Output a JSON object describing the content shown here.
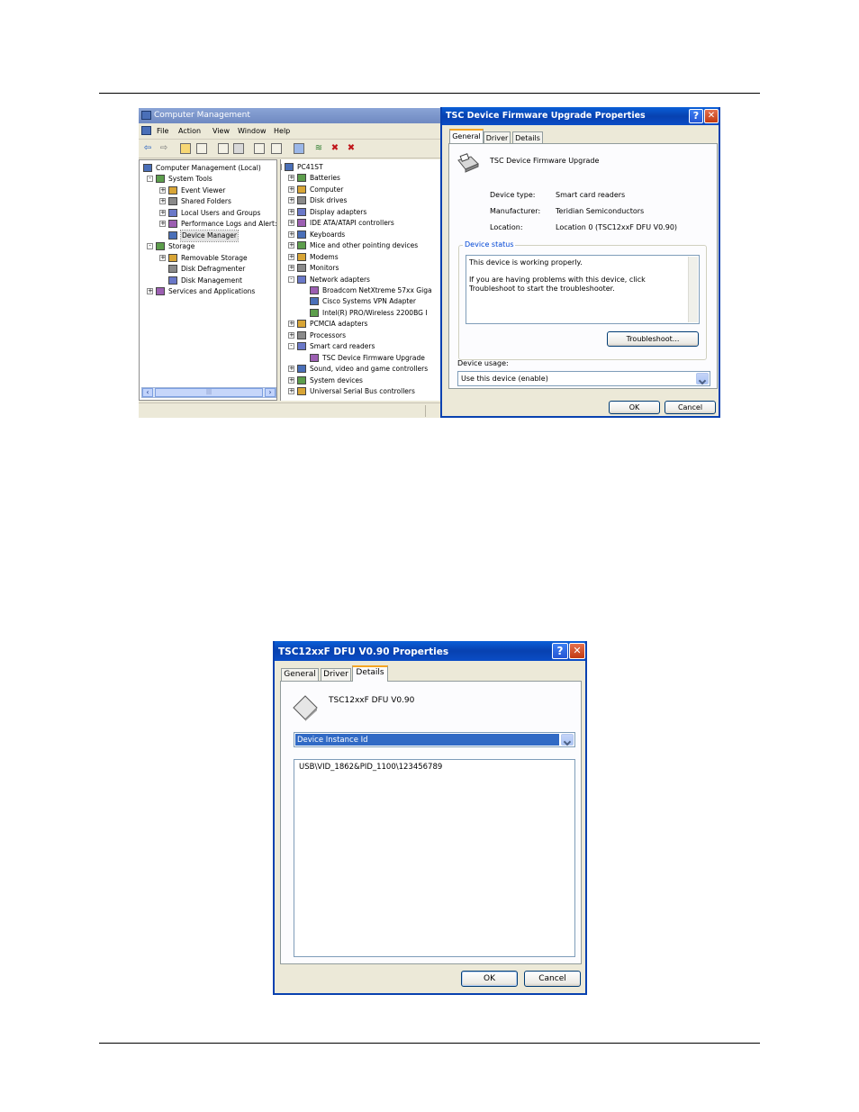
{
  "computer_management": {
    "title": "Computer Management",
    "menu": [
      "File",
      "Action",
      "View",
      "Window",
      "Help"
    ],
    "left_tree": [
      {
        "label": "Computer Management (Local)",
        "level": 0,
        "expander": "",
        "icon": "computer-icon"
      },
      {
        "label": "System Tools",
        "level": 1,
        "expander": "-",
        "icon": "tools-icon"
      },
      {
        "label": "Event Viewer",
        "level": 2,
        "expander": "+",
        "icon": "event-viewer-icon"
      },
      {
        "label": "Shared Folders",
        "level": 2,
        "expander": "+",
        "icon": "folder-icon"
      },
      {
        "label": "Local Users and Groups",
        "level": 2,
        "expander": "+",
        "icon": "users-icon"
      },
      {
        "label": "Performance Logs and Alert:",
        "level": 2,
        "expander": "+",
        "icon": "performance-icon"
      },
      {
        "label": "Device Manager",
        "level": 2,
        "expander": "",
        "icon": "device-manager-icon",
        "selected": true
      },
      {
        "label": "Storage",
        "level": 1,
        "expander": "-",
        "icon": "storage-icon"
      },
      {
        "label": "Removable Storage",
        "level": 2,
        "expander": "+",
        "icon": "removable-storage-icon"
      },
      {
        "label": "Disk Defragmenter",
        "level": 2,
        "expander": "",
        "icon": "defrag-icon"
      },
      {
        "label": "Disk Management",
        "level": 2,
        "expander": "",
        "icon": "disk-icon"
      },
      {
        "label": "Services and Applications",
        "level": 1,
        "expander": "+",
        "icon": "services-icon"
      }
    ],
    "right_tree": [
      {
        "label": "PC41ST",
        "level": 0,
        "expander": "-",
        "icon": "computer-icon"
      },
      {
        "label": "Batteries",
        "level": 1,
        "expander": "+",
        "icon": "battery-icon"
      },
      {
        "label": "Computer",
        "level": 1,
        "expander": "+",
        "icon": "computer-icon"
      },
      {
        "label": "Disk drives",
        "level": 1,
        "expander": "+",
        "icon": "disk-icon"
      },
      {
        "label": "Display adapters",
        "level": 1,
        "expander": "+",
        "icon": "display-icon"
      },
      {
        "label": "IDE ATA/ATAPI controllers",
        "level": 1,
        "expander": "+",
        "icon": "ide-icon"
      },
      {
        "label": "Keyboards",
        "level": 1,
        "expander": "+",
        "icon": "keyboard-icon"
      },
      {
        "label": "Mice and other pointing devices",
        "level": 1,
        "expander": "+",
        "icon": "mouse-icon"
      },
      {
        "label": "Modems",
        "level": 1,
        "expander": "+",
        "icon": "modem-icon"
      },
      {
        "label": "Monitors",
        "level": 1,
        "expander": "+",
        "icon": "monitor-icon"
      },
      {
        "label": "Network adapters",
        "level": 1,
        "expander": "-",
        "icon": "network-icon"
      },
      {
        "label": "Broadcom NetXtreme 57xx Giga",
        "level": 2,
        "expander": "",
        "icon": "network-card-icon"
      },
      {
        "label": "Cisco Systems VPN Adapter",
        "level": 2,
        "expander": "",
        "icon": "network-card-icon"
      },
      {
        "label": "Intel(R) PRO/Wireless 2200BG I",
        "level": 2,
        "expander": "",
        "icon": "network-card-icon"
      },
      {
        "label": "PCMCIA adapters",
        "level": 1,
        "expander": "+",
        "icon": "pcmcia-icon"
      },
      {
        "label": "Processors",
        "level": 1,
        "expander": "+",
        "icon": "processor-icon"
      },
      {
        "label": "Smart card readers",
        "level": 1,
        "expander": "-",
        "icon": "smart-card-reader-icon"
      },
      {
        "label": "TSC Device Firmware Upgrade",
        "level": 2,
        "expander": "",
        "icon": "smart-card-reader-icon"
      },
      {
        "label": "Sound, video and game controllers",
        "level": 1,
        "expander": "+",
        "icon": "sound-icon"
      },
      {
        "label": "System devices",
        "level": 1,
        "expander": "+",
        "icon": "system-icon"
      },
      {
        "label": "Universal Serial Bus controllers",
        "level": 1,
        "expander": "+",
        "icon": "usb-icon"
      }
    ]
  },
  "tsc_properties": {
    "title": "TSC Device Firmware Upgrade Properties",
    "help_glyph": "?",
    "close_glyph": "✕",
    "tabs": [
      "General",
      "Driver",
      "Details"
    ],
    "device_name": "TSC Device Firmware Upgrade",
    "device_type_label": "Device type:",
    "device_type_value": "Smart card readers",
    "manufacturer_label": "Manufacturer:",
    "manufacturer_value": "Teridian Semiconductors",
    "location_label": "Location:",
    "location_value": "Location 0 (TSC12xxF DFU V0.90)",
    "status_group_label": "Device status",
    "status_line1": "This device is working properly.",
    "status_line2": "If you are having problems with this device, click Troubleshoot to start the troubleshooter.",
    "troubleshoot_label": "Troubleshoot...",
    "usage_label": "Device usage:",
    "usage_value": "Use this device (enable)",
    "ok_label": "OK",
    "cancel_label": "Cancel"
  },
  "dfu_properties": {
    "title": "TSC12xxF DFU V0.90 Properties",
    "help_glyph": "?",
    "close_glyph": "✕",
    "tabs": [
      "General",
      "Driver",
      "Details"
    ],
    "device_name": "TSC12xxF DFU V0.90",
    "property_selected": "Device Instance Id",
    "property_value": "USB\\VID_1862&PID_1100\\123456789",
    "ok_label": "OK",
    "cancel_label": "Cancel"
  },
  "colors": {
    "xp_title_blue": "#0a4cc6",
    "dialog_bg": "#ece9d8",
    "selection_blue": "#316ac5",
    "link_blue": "#0046d5"
  }
}
